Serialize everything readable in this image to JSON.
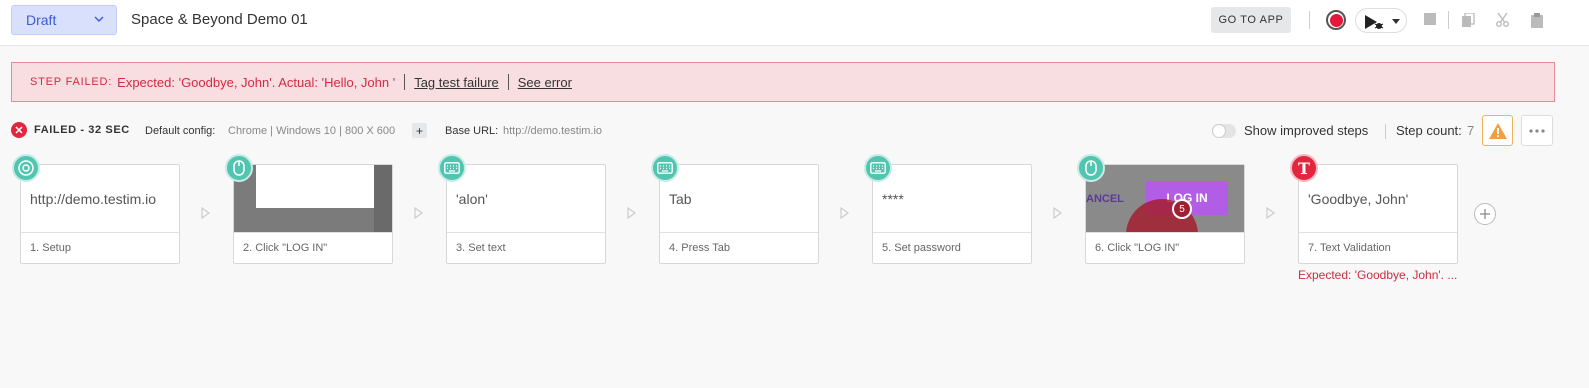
{
  "header": {
    "status_select": "Draft",
    "test_name": "Space & Beyond Demo 01",
    "go_to_app": "GO TO APP"
  },
  "banner": {
    "label": "STEP FAILED:",
    "message": "Expected: 'Goodbye, John'. Actual: 'Hello, John '",
    "tag_link": "Tag test failure",
    "error_link": "See error"
  },
  "status": {
    "result": "FAILED - 32 SEC",
    "config_label": "Default config:",
    "config_value": "Chrome | Windows 10 | 800 X 600",
    "add_label": "+",
    "base_url_label": "Base URL:",
    "base_url_value": "http://demo.testim.io",
    "improved_steps_label": "Show improved steps",
    "improved_steps_on": false,
    "step_count_label": "Step count:",
    "step_count": "7"
  },
  "steps": [
    {
      "label": "1. Setup",
      "preview": "http://demo.testim.io",
      "icon": "chrome-icon"
    },
    {
      "label": "2. Click \"LOG IN\"",
      "preview": "",
      "icon": "mouse-icon"
    },
    {
      "label": "3. Set text",
      "preview": "'alon'",
      "icon": "keyboard-icon"
    },
    {
      "label": "4. Press Tab",
      "preview": "Tab",
      "icon": "keyboard-icon"
    },
    {
      "label": "5. Set password",
      "preview": "****",
      "icon": "keyboard-icon"
    },
    {
      "label": "6. Click \"LOG IN\"",
      "preview": "",
      "icon": "mouse-icon"
    },
    {
      "label": "7. Text Validation",
      "preview": "'Goodbye, John'",
      "icon": "text-validation-icon"
    }
  ],
  "thumb6": {
    "cancel": "ANCEL",
    "login": "LOG IN",
    "badge": "5"
  },
  "step_error": "Expected: 'Goodbye, John'. ...",
  "colors": {
    "accent": "#3f5bd0",
    "failed": "#e3263f",
    "step_badge": "#52c5b0",
    "banner_bg": "#f8dde1",
    "warning": "#f0a040"
  }
}
